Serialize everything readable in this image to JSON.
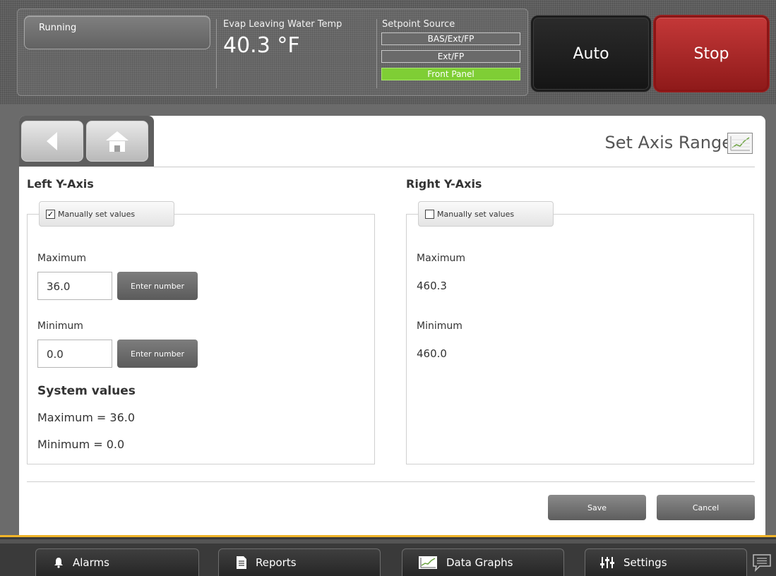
{
  "header": {
    "status": "Running",
    "evap_label": "Evap Leaving Water Temp",
    "evap_value": "40.3 °F",
    "setpoint_source": {
      "label": "Setpoint Source",
      "options": [
        "BAS/Ext/FP",
        "Ext/FP",
        "Front Panel"
      ],
      "active": "Front Panel"
    },
    "auto_label": "Auto",
    "stop_label": "Stop"
  },
  "page": {
    "title": "Set Axis Range",
    "icon": "chart-icon"
  },
  "left_axis": {
    "heading": "Left Y-Axis",
    "manual_label": "Manually set values",
    "manual_checked": true,
    "maximum_label": "Maximum",
    "maximum_value": "36.0",
    "minimum_label": "Minimum",
    "minimum_value": "0.0",
    "enter_label": "Enter number",
    "system_heading": "System values",
    "system_max": "Maximum = 36.0",
    "system_min": "Minimum = 0.0"
  },
  "right_axis": {
    "heading": "Right Y-Axis",
    "manual_label": "Manually set values",
    "manual_checked": false,
    "maximum_label": "Maximum",
    "maximum_value": "460.3",
    "minimum_label": "Minimum",
    "minimum_value": "460.0"
  },
  "actions": {
    "save": "Save",
    "cancel": "Cancel"
  },
  "bottom_nav": {
    "alarms": "Alarms",
    "reports": "Reports",
    "data_graphs": "Data Graphs",
    "settings": "Settings"
  },
  "colors": {
    "accent": "#f0b429",
    "active_source": "#7fce35",
    "stop": "#b22a2a"
  }
}
